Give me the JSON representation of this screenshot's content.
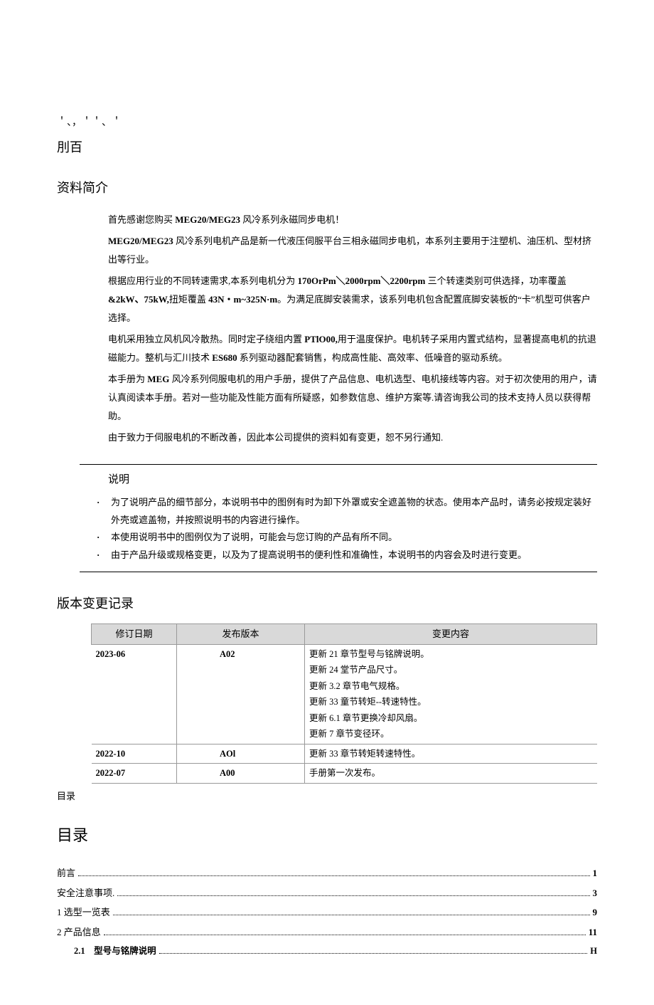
{
  "header": {
    "noise": "＇、，＇＇、＇",
    "title": "刖百"
  },
  "intro": {
    "title": "资料简介",
    "p1_pre": "首先感谢您购买 ",
    "p1_bold": "MEG20/MEG23",
    "p1_post": " 风冷系列永磁同步电机！",
    "p2_bold": "MEG20/MEG23",
    "p2_post": " 风冷系列电机产品是新一代液压伺服平台三相永磁同步电机，本系列主要用于注塑机、油压机、型材挤出等行业。",
    "p3_pre": "根据应用行业的不同转速需求,本系列电机分为 ",
    "p3_bold1": "170OrPm＼2000rpm＼2200rpm",
    "p3_mid1": " 三个转速类别可供选择，功率覆盖",
    "p3_bold2": "&2kW、75kW,",
    "p3_mid2": "扭矩覆盖 ",
    "p3_bold3": "43N・m~325N·m",
    "p3_post": "。为满足底脚安装需求，该系列电机包含配置底脚安装板的“卡”机型可供客户选择。",
    "p4_pre": "电机采用独立风机风冷散热。同时定子绕组内置 ",
    "p4_bold1": "PTlO00,",
    "p4_mid1": "用于温度保护。电机转子采用内置式结构，显著提高电机的抗退磁能力。整机与汇川技术 ",
    "p4_bold2": "ES680",
    "p4_post": " 系列驱动器配套销售，构成高性能、高效率、低噪音的驱动系统。",
    "p5_pre": "本手册为 ",
    "p5_bold": "MEG",
    "p5_post": " 风冷系列伺服电机的用户手册，提供了产品信息、电机选型、电机接线等内容。对于初次使用的用户，请认真阅读本手册。若对一些功能及性能方面有所疑惑，如参数信息、维护方案等.请咨询我公司的技术支持人员以获得帮助。",
    "p6": "由于致力于伺服电机的不断改善，因此本公司提供的资料如有变更，恕不另行通知."
  },
  "note": {
    "title": "说明",
    "items": [
      "为了说明产品的细节部分，本说明书中的图例有时为卸下外罩或安全遮盖物的状态。使用本产品时，请务必按规定装好外壳或遮盖物，并按照说明书的内容进行操作。",
      "本使用说明书中的图例仅为了说明，可能会与您订购的产品有所不同。",
      "由于产品升级或规格变更，以及为了提高说明书的便利性和准确性，本说明书的内容会及时进行变更。"
    ]
  },
  "revision": {
    "title": "版本变更记录",
    "headers": [
      "修订日期",
      "发布版本",
      "变更内容"
    ],
    "rows": [
      {
        "date": "2023-06",
        "version": "A02",
        "changes": [
          "更新 21 章节型号与铭牌说明。",
          "更新 24 堂节产品尺寸。",
          "更新 3.2 章节电气规格。",
          "更新 33 童节转矩--转速特性。",
          "更新 6.1 章节更换冷却风扇。",
          "更新 7 章节变径环。"
        ]
      },
      {
        "date": "2022-10",
        "version": "AOl",
        "changes": [
          "更新 33 章节转矩转速特性。"
        ]
      },
      {
        "date": "2022-07",
        "version": "A00",
        "changes": [
          "手册第一次发布。"
        ]
      }
    ],
    "sidelabel": "目录"
  },
  "toc": {
    "title": "目录",
    "items": [
      {
        "label": "前言",
        "page": "1",
        "indent": 0
      },
      {
        "label": "安全注意事项.",
        "page": "3",
        "indent": 0
      },
      {
        "label": "1 选型一览表",
        "page": "9",
        "indent": 0
      },
      {
        "label": "2 产品信息 ",
        "page": "11",
        "indent": 0
      },
      {
        "label": "2.1　型号与铭牌说明",
        "page": "H",
        "indent": 1
      }
    ]
  }
}
